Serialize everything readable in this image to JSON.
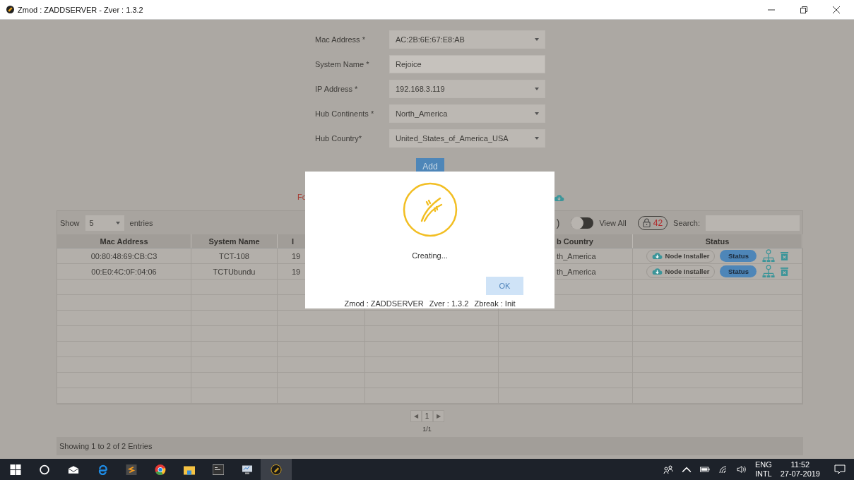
{
  "window": {
    "title": "Zmod : ZADDSERVER - Zver : 1.3.2"
  },
  "form": {
    "fields": [
      {
        "label": "Mac Address *",
        "value": "AC:2B:6E:67:E8:AB",
        "kind": "select"
      },
      {
        "label": "System Name *",
        "value": "Rejoice",
        "kind": "text"
      },
      {
        "label": "IP Address *",
        "value": "192.168.3.119",
        "kind": "select"
      },
      {
        "label": "Hub Continents *",
        "value": "North_America",
        "kind": "select"
      },
      {
        "label": "Hub Country*",
        "value": "United_States_of_America_USA",
        "kind": "select"
      }
    ],
    "add_button": "Add"
  },
  "notice_fragment": "Fo",
  "toolbar": {
    "show_label": "Show",
    "page_size": "5",
    "entries_label": "entries",
    "fragment": ")",
    "view_all": {
      "label": "View All",
      "on": false
    },
    "lock_count": "42",
    "search_label": "Search:"
  },
  "table": {
    "columns": [
      {
        "label": "Mac Address"
      },
      {
        "label": "System Name"
      },
      {
        "label": "I"
      },
      {
        "label": "b Country"
      },
      {
        "label": "Status"
      }
    ],
    "rows": [
      {
        "mac": "00:80:48:69:CB:C3",
        "system_name": "TCT-108",
        "ip": "19",
        "hub_country": "th_America",
        "installer": "Node Installer",
        "status": "Status"
      },
      {
        "mac": "00:E0:4C:0F:04:06",
        "system_name": "TCTUbundu",
        "ip": "19",
        "hub_country": "th_America",
        "installer": "Node Installer",
        "status": "Status"
      }
    ]
  },
  "pagination": {
    "prev": "◀",
    "page": "1",
    "next": "▶",
    "summary": "1/1"
  },
  "footer": "Showing 1 to 2 of 2 Entries",
  "dialog": {
    "message": "Creating...",
    "ok_button": {
      "label": "OK",
      "disabled": true
    },
    "info": [
      "Zmod : ZADDSERVER",
      "Zver : 1.3.2",
      "Zbreak : Init"
    ]
  },
  "taskbar": {
    "apps": [
      {
        "selected": false
      },
      {
        "selected": false
      },
      {
        "selected": false
      },
      {
        "selected": false
      },
      {
        "selected": false
      },
      {
        "selected": false
      },
      {
        "selected": false
      },
      {
        "selected": false
      },
      {
        "selected": false
      },
      {
        "selected": true
      }
    ],
    "language": "ENG",
    "layout": "INTL",
    "time": "11:52",
    "date": "27-07-2019"
  }
}
